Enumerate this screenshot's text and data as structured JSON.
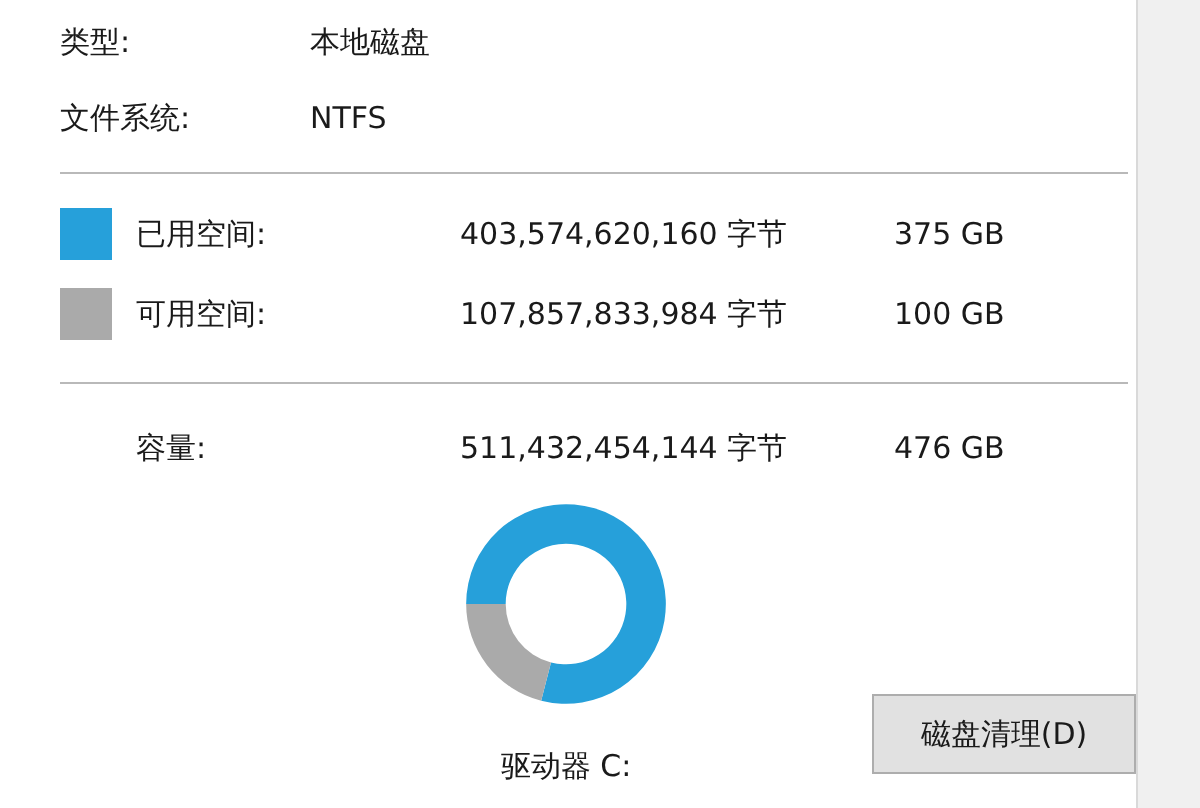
{
  "info": [
    {
      "label": "类型:",
      "value": "本地磁盘"
    },
    {
      "label": "文件系统:",
      "value": "NTFS"
    }
  ],
  "space": [
    {
      "label": "已用空间:",
      "bytes": "403,574,620,160 字节",
      "size": "375 GB",
      "color": "#26a0da"
    },
    {
      "label": "可用空间:",
      "bytes": "107,857,833,984 字节",
      "size": "100 GB",
      "color": "#aaaaaa"
    }
  ],
  "capacity": {
    "label": "容量:",
    "bytes": "511,432,454,144 字节",
    "size": "476 GB"
  },
  "drive_label": "驱动器 C:",
  "cleanup_button": "磁盘清理(D)"
}
